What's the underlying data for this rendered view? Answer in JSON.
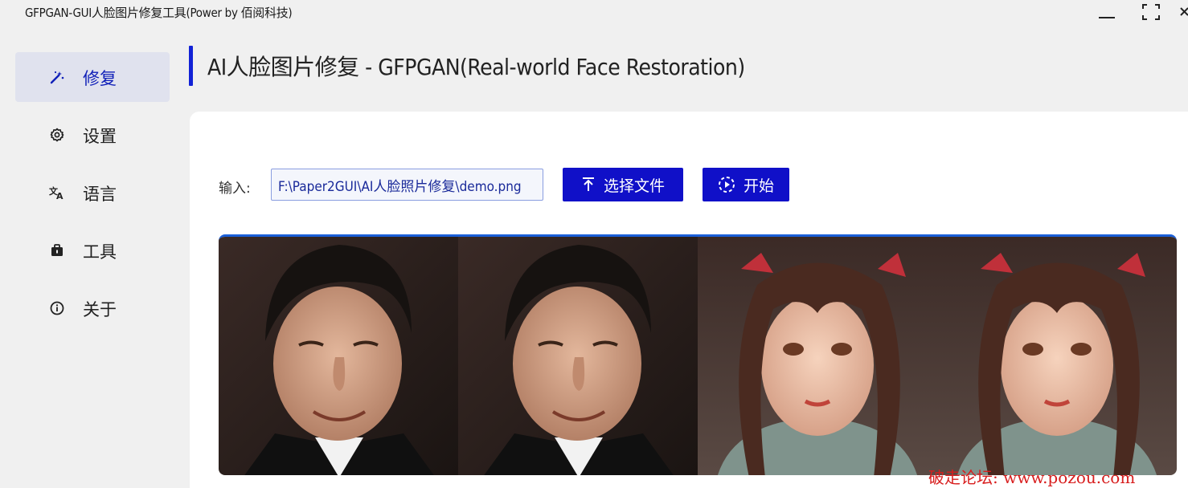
{
  "window": {
    "title": "GFPGAN-GUI人脸图片修复工具(Power by 佰阅科技)"
  },
  "sidebar": {
    "items": [
      {
        "label": "修复",
        "icon": "magic-wand-icon",
        "active": true
      },
      {
        "label": "设置",
        "icon": "gear-icon",
        "active": false
      },
      {
        "label": "语言",
        "icon": "translate-icon",
        "active": false
      },
      {
        "label": "工具",
        "icon": "toolbox-icon",
        "active": false
      },
      {
        "label": "关于",
        "icon": "info-icon",
        "active": false
      }
    ]
  },
  "page": {
    "title": "AI人脸图片修复 - GFPGAN(Real-world Face Restoration)"
  },
  "form": {
    "input_label": "输入:",
    "input_value": "F:\\Paper2GUI\\AI人脸照片修复\\demo.png",
    "select_file_label": "选择文件",
    "start_label": "开始"
  },
  "watermark": "破走论坛: www.pozou.com",
  "colors": {
    "accent": "#1010c8",
    "active_nav_bg": "#e0e2ee",
    "watermark": "#d81e1e"
  }
}
